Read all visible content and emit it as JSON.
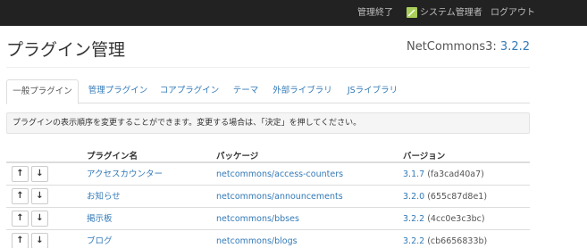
{
  "topbar": {
    "exit_label": "管理終了",
    "user_label": "システム管理者",
    "logout_label": "ログアウト"
  },
  "page": {
    "title": "プラグイン管理",
    "nc_label": "NetCommons3:",
    "nc_version": "3.2.2"
  },
  "tabs": [
    {
      "label": "一般プラグイン",
      "active": true
    },
    {
      "label": "管理プラグイン"
    },
    {
      "label": "コアプラグイン"
    },
    {
      "label": "テーマ"
    },
    {
      "label": "外部ライブラリ"
    },
    {
      "label": "JSライブラリ"
    }
  ],
  "info_text": "プラグインの表示順序を変更することができます。変更する場合は、「決定」を押してください。",
  "table": {
    "columns": [
      "プラグイン名",
      "パッケージ",
      "バージョン"
    ],
    "move_up": "↑",
    "move_down": "↓",
    "rows": [
      {
        "name": "アクセスカウンター",
        "package": "netcommons/access-counters",
        "version": "3.1.7",
        "hash": "(fa3cad40a7)"
      },
      {
        "name": "お知らせ",
        "package": "netcommons/announcements",
        "version": "3.2.0",
        "hash": "(655c87d8e1)"
      },
      {
        "name": "掲示板",
        "package": "netcommons/bbses",
        "version": "3.2.2",
        "hash": "(4cc0e3c3bc)"
      },
      {
        "name": "ブログ",
        "package": "netcommons/blogs",
        "version": "3.2.2",
        "hash": "(cb6656833b)"
      }
    ]
  },
  "colors": {
    "navbar_bg": "#222222",
    "link": "#337ab7",
    "user_icon": "#a9cf5a"
  }
}
